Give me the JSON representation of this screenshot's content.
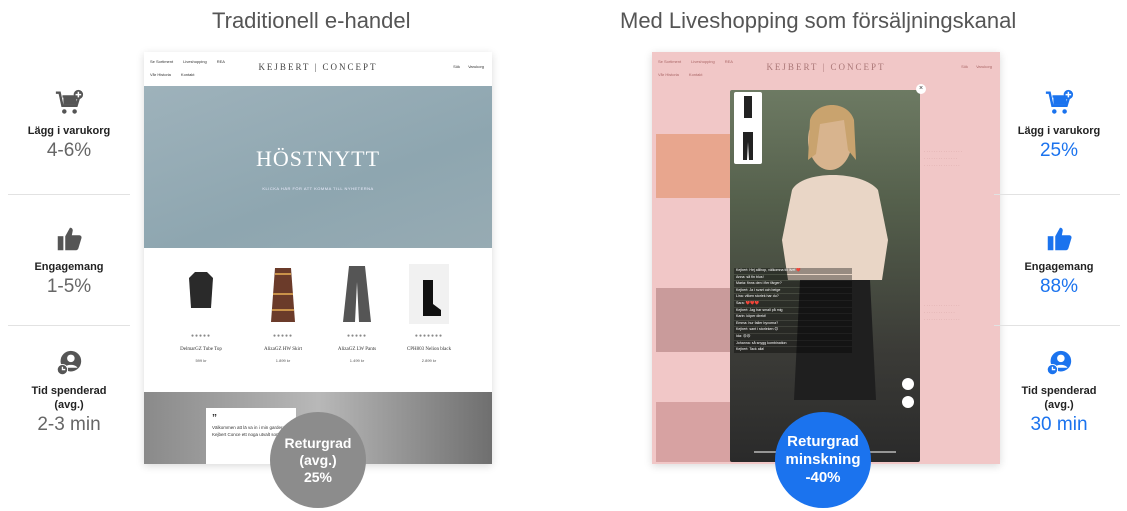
{
  "headings": {
    "left": "Traditionell e-handel",
    "right": "Med Liveshopping som försäljningskanal"
  },
  "left_stats": [
    {
      "icon": "cart-plus-icon",
      "label": "Lägg i varukorg",
      "value": "4-6%"
    },
    {
      "icon": "thumbs-up-icon",
      "label": "Engagemang",
      "value": "1-5%"
    },
    {
      "icon": "clock-user-icon",
      "label": "Tid spenderad (avg.)",
      "value": "2-3 min"
    }
  ],
  "right_stats": [
    {
      "icon": "cart-plus-icon",
      "label": "Lägg i varukorg",
      "value": "25%"
    },
    {
      "icon": "thumbs-up-icon",
      "label": "Engagemang",
      "value": "88%"
    },
    {
      "icon": "clock-user-icon",
      "label": "Tid spenderad (avg.)",
      "value": "30 min"
    }
  ],
  "left_badge": {
    "line1": "Returgrad",
    "line2": "(avg.)",
    "line3": "25%"
  },
  "right_badge": {
    "line1": "Returgrad",
    "line2": "minskning",
    "line3": "-40%"
  },
  "site": {
    "brand": "KEJBERT | CONCEPT",
    "nav": [
      "Se Sortiment",
      "Liveshopping",
      "REA"
    ],
    "nav2": [
      "Vår Historia",
      "Kontakt"
    ],
    "tools": [
      "Sök",
      "Varukorg"
    ],
    "hero_title": "HÖSTNYTT",
    "hero_sub": "KLICKA HÄR FÖR ATT KOMMA TILL NYHETERNA",
    "products": [
      {
        "name": "DelmarGZ Tube Top",
        "price": "599 kr"
      },
      {
        "name": "AlizaGZ HW Skirt",
        "price": "1.899 kr"
      },
      {
        "name": "AlizaGZ LW Pants",
        "price": "1.499 kr"
      },
      {
        "name": "CPH803 Nelion black",
        "price": "2.899 kr"
      }
    ],
    "quote": "Välkommen att lä va in i min garderob! Kejbert Conce ett noga utvalt sortime..."
  },
  "colors": {
    "accent_blue": "#1b73ee",
    "grey_badge": "#8c8c8c",
    "pink_site": "#f1c7c7"
  }
}
